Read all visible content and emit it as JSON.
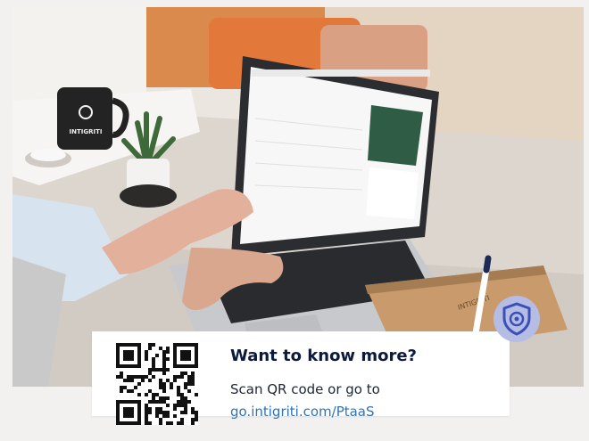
{
  "card": {
    "headline": "Want to know more?",
    "subline": "Scan QR code or go to",
    "link": "go.intigriti.com/PtaaS"
  },
  "photo": {
    "mug_brand": "INTIGRITI",
    "notebook_brand": "INTIGRITI"
  },
  "icons": {
    "badge": "shield-icon",
    "qr": "qr-code"
  },
  "colors": {
    "headline": "#0c1a3d",
    "link": "#2e73b8",
    "badge_bg": "#b5bde4",
    "badge_icon": "#3b4fb6"
  }
}
